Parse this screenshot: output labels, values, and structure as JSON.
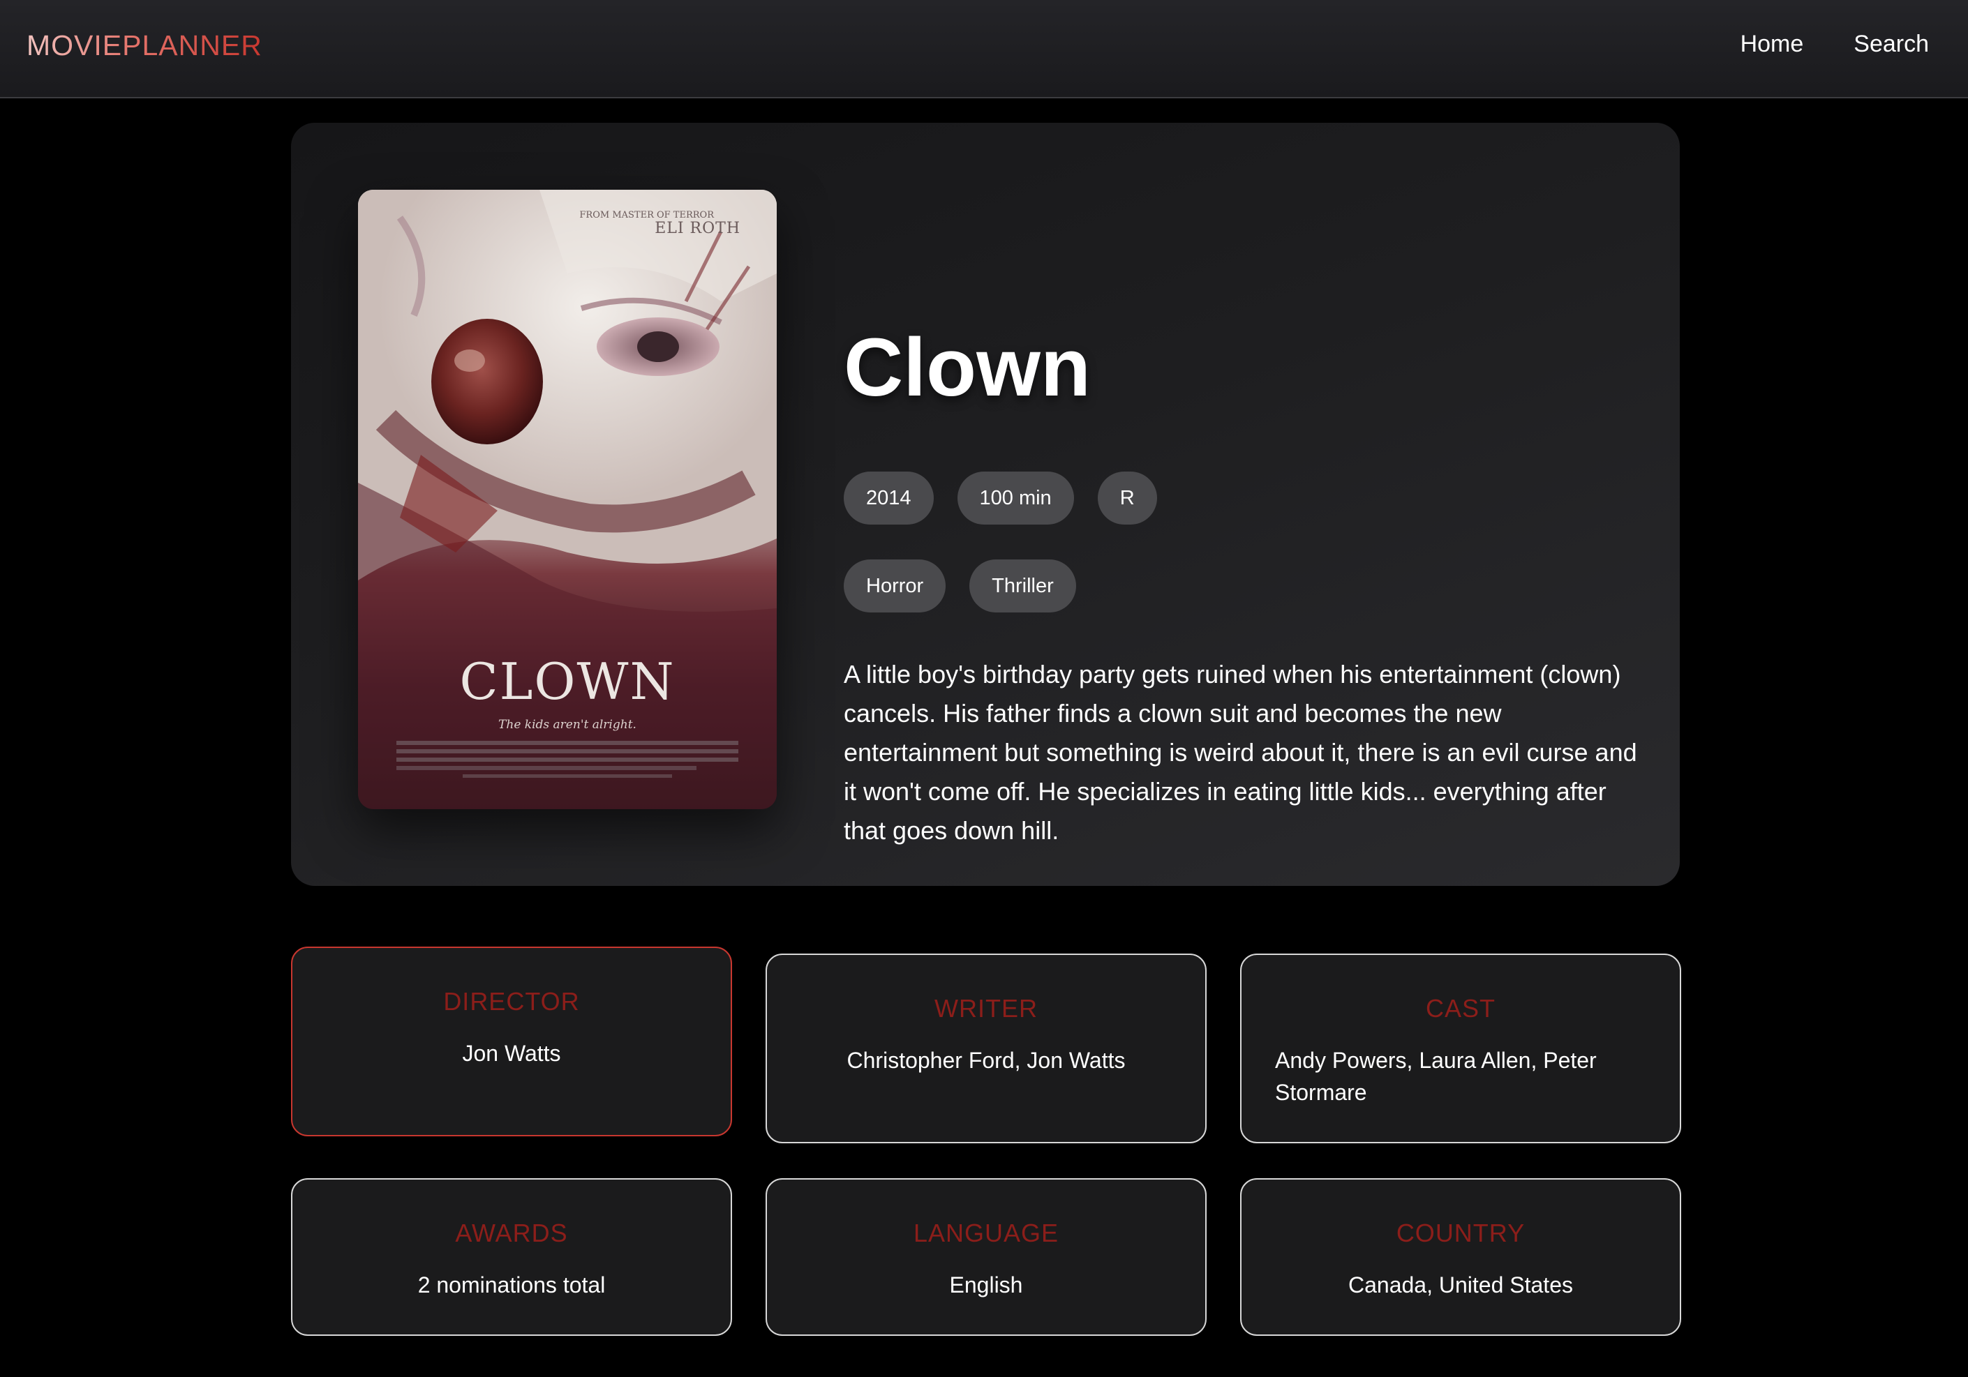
{
  "navbar": {
    "brand": "MOVIEPLANNER",
    "links": [
      "Home",
      "Search"
    ]
  },
  "movie": {
    "title": "Clown",
    "year": "2014",
    "runtime": "100 min",
    "rating": "R",
    "genres": [
      "Horror",
      "Thriller"
    ],
    "plot": "A little boy's birthday party gets ruined when his entertainment (clown) cancels. His father finds a clown suit and becomes the new entertainment but something is weird about it, there is an evil curse and it won't come off. He specializes in eating little kids... everything after that goes down hill.",
    "poster": {
      "tagline_top_1": "FROM MASTER OF TERROR",
      "tagline_top_2": "ELI ROTH",
      "title": "CLOWN",
      "tagline": "The kids aren't alright."
    }
  },
  "info": {
    "director": {
      "label": "DIRECTOR",
      "value": "Jon Watts"
    },
    "writer": {
      "label": "WRITER",
      "value": "Christopher Ford, Jon Watts"
    },
    "cast": {
      "label": "CAST",
      "value": "Andy Powers, Laura Allen, Peter Stormare"
    },
    "awards": {
      "label": "AWARDS",
      "value": "2 nominations total"
    },
    "language": {
      "label": "LANGUAGE",
      "value": "English"
    },
    "country": {
      "label": "COUNTRY",
      "value": "Canada, United States"
    }
  },
  "colors": {
    "accent": "#c8372f",
    "label": "#8c1e1a",
    "pill": "#4a4a4d",
    "card": "#1b1b1c"
  }
}
